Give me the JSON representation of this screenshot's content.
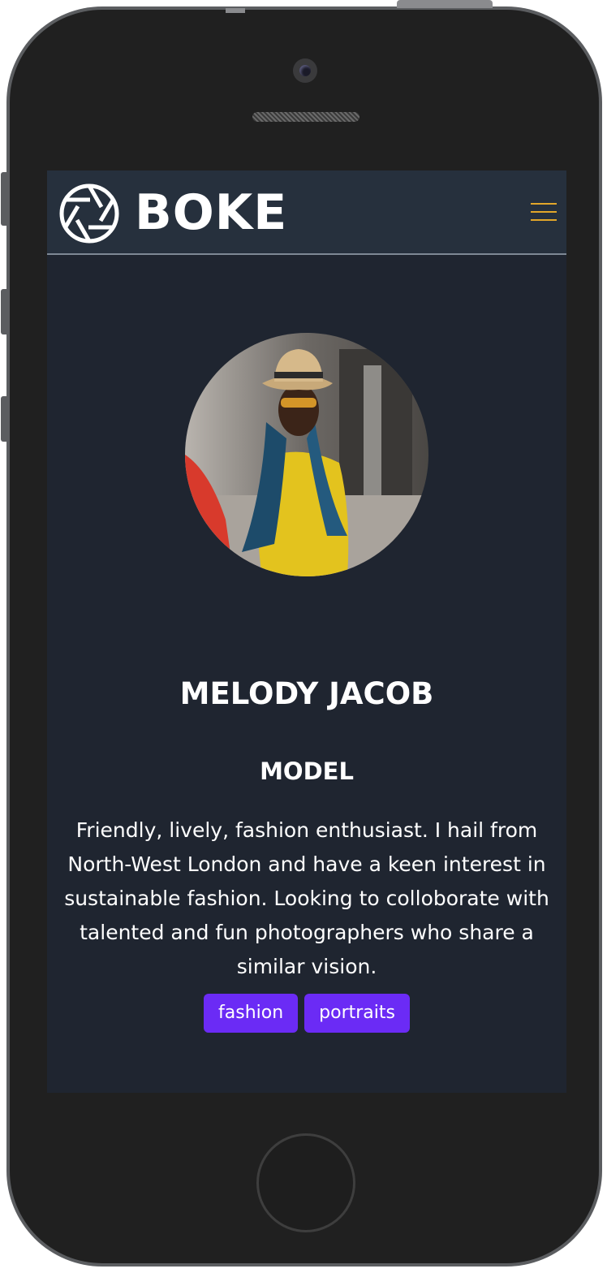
{
  "brand": {
    "name": "BOKE",
    "logo_icon": "camera-shutter-icon"
  },
  "navbar": {
    "menu_icon": "hamburger-menu-icon",
    "accent_color": "#e2a62a"
  },
  "profile": {
    "photo_icon": "profile-photo",
    "name": "MELODY JACOB",
    "role": "MODEL",
    "bio": "Friendly, lively, fashion enthusiast. I hail from North-West London and have a keen interest in sustainable fashion. Looking to colloborate with talented and fun photographers who share a similar vision.",
    "tags": [
      "fashion",
      "portraits"
    ],
    "tag_color": "#6b2bf5"
  },
  "theme": {
    "screen_background": "#1f2530",
    "navbar_background": "#26303d",
    "phone_body": "#202020"
  }
}
